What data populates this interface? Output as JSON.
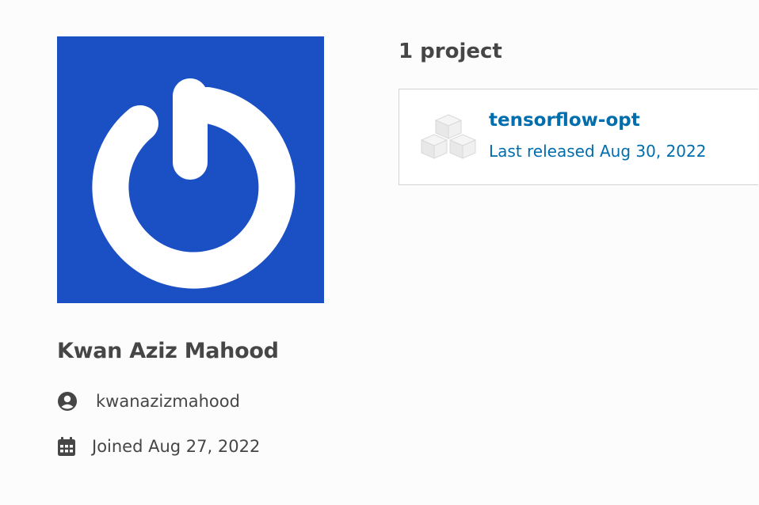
{
  "profile": {
    "full_name": "Kwan Aziz Mahood",
    "username": "kwanazizmahood",
    "joined": "Joined Aug 27, 2022",
    "avatar_background": "#1b4fc4",
    "username_icon": "user-circle-icon",
    "joined_icon": "calendar-icon"
  },
  "projects": {
    "heading": "1 project",
    "items": [
      {
        "name": "tensorflow-opt",
        "released": "Last released Aug 30, 2022",
        "icon": "package-boxes-icon"
      }
    ]
  },
  "colors": {
    "link": "#006dad",
    "text": "#464646",
    "background": "#fcfcfc"
  }
}
